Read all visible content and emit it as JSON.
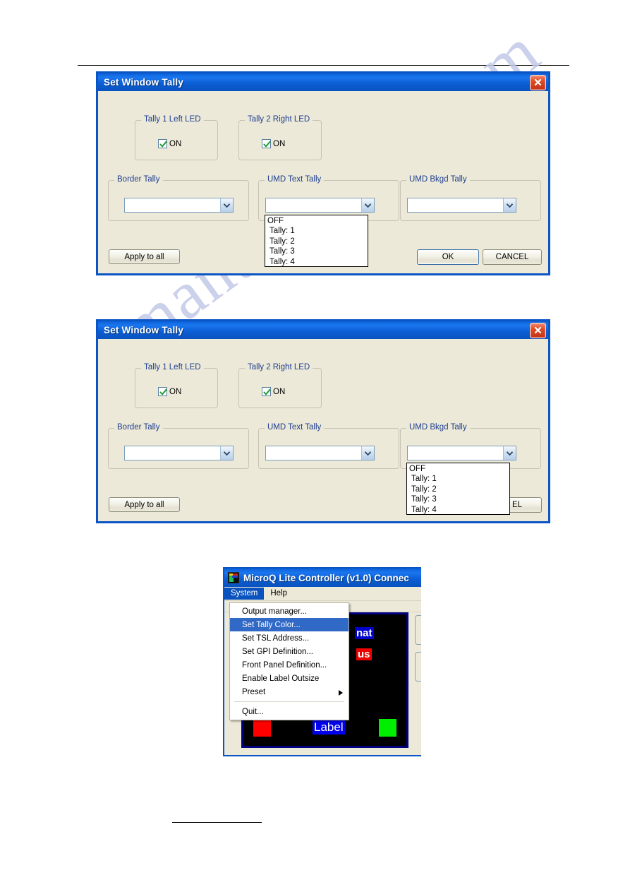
{
  "watermark": {
    "text": "manualshive.com"
  },
  "dialog1": {
    "title": "Set Window Tally",
    "close_icon": "close-icon",
    "groups": {
      "tally1": {
        "title": "Tally 1 Left LED",
        "checkbox_label": "ON",
        "checked": true
      },
      "tally2": {
        "title": "Tally 2 Right LED",
        "checkbox_label": "ON",
        "checked": true
      },
      "border": {
        "title": "Border Tally",
        "value": ""
      },
      "umd_text": {
        "title": "UMD Text Tally",
        "value": ""
      },
      "umd_bkgd": {
        "title": "UMD Bkgd Tally",
        "value": ""
      }
    },
    "open_dropdown": {
      "owner": "UMD Text Tally",
      "options": [
        "OFF",
        "Tally: 1",
        "Tally: 2",
        "Tally: 3",
        "Tally: 4"
      ]
    },
    "buttons": {
      "apply": "Apply to all",
      "ok": "OK",
      "cancel": "CANCEL"
    }
  },
  "dialog2": {
    "title": "Set Window Tally",
    "close_icon": "close-icon",
    "groups": {
      "tally1": {
        "title": "Tally 1 Left LED",
        "checkbox_label": "ON",
        "checked": true
      },
      "tally2": {
        "title": "Tally 2 Right LED",
        "checkbox_label": "ON",
        "checked": true
      },
      "border": {
        "title": "Border Tally",
        "value": ""
      },
      "umd_text": {
        "title": "UMD Text Tally",
        "value": ""
      },
      "umd_bkgd": {
        "title": "UMD Bkgd Tally",
        "value": ""
      }
    },
    "open_dropdown": {
      "owner": "UMD Bkgd Tally",
      "options": [
        "OFF",
        "Tally: 1",
        "Tally: 2",
        "Tally: 3",
        "Tally: 4"
      ]
    },
    "buttons": {
      "apply": "Apply to all",
      "cancel_partial": "EL"
    }
  },
  "app_window": {
    "title": "MicroQ Lite Controller (v1.0) Connec",
    "icon": "microq-app-icon",
    "menubar": [
      {
        "label": "System",
        "active": true
      },
      {
        "label": "Help",
        "active": false
      }
    ],
    "menu": {
      "items": [
        {
          "label": "Output manager...",
          "selected": false,
          "submenu": false
        },
        {
          "label": "Set Tally Color...",
          "selected": true,
          "submenu": false
        },
        {
          "label": "Set TSL Address...",
          "selected": false,
          "submenu": false
        },
        {
          "label": "Set GPI Definition...",
          "selected": false,
          "submenu": false
        },
        {
          "label": "Front Panel Definition...",
          "selected": false,
          "submenu": false
        },
        {
          "label": "Enable Label Outsize",
          "selected": false,
          "submenu": false
        },
        {
          "label": "Preset",
          "selected": false,
          "submenu": true
        }
      ],
      "quit": {
        "label": "Quit...",
        "selected": false
      }
    },
    "preview": {
      "format_text": "nat",
      "format_bg": "#0000cc",
      "format_fg": "#ffffff",
      "status_text": "us",
      "status_bg": "#ee0000",
      "status_fg": "#ffffff",
      "label_text": "Label",
      "label_bg": "#0000ee",
      "label_fg": "#ffffff",
      "left_swatch_color": "#ff0000",
      "right_swatch_color": "#00ee00",
      "background": "#000000",
      "border_color": "#000080"
    }
  },
  "colors": {
    "title_blue": "#0B54C4",
    "dialog_face": "#ece9d8",
    "group_label": "#1F3F8F",
    "menu_highlight": "#3169C6",
    "watermark": "#c3c8e8"
  }
}
